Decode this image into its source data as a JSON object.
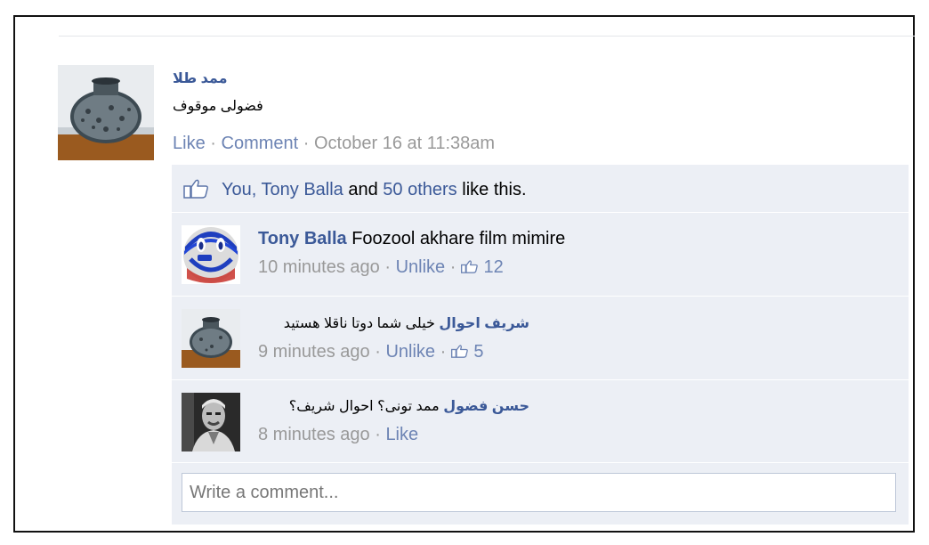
{
  "post": {
    "author": "ممد طلا",
    "text": "فضولی موقوف",
    "like_label": "Like",
    "comment_label": "Comment",
    "timestamp": "October 16 at 11:38am",
    "separator": "·"
  },
  "likes": {
    "you": "You,",
    "person": "Tony Balla",
    "and": "and",
    "others": "50 others",
    "suffix": "like this."
  },
  "comments": [
    {
      "author": "Tony Balla",
      "text": "Foozool akhare film mimire",
      "time": "10 minutes ago",
      "action": "Unlike",
      "like_count": "12"
    },
    {
      "author": "شریف احوال",
      "text": "خیلی شما دوتا ناقلا هستید",
      "time": "9 minutes ago",
      "action": "Unlike",
      "like_count": "5"
    },
    {
      "author": "حسن فضول",
      "text": "ممد تونی؟ احوال شریف؟",
      "time": "8 minutes ago",
      "action": "Like"
    }
  ],
  "composer": {
    "placeholder": "Write a comment..."
  },
  "icons": {
    "like": "thumbs-up-icon"
  },
  "colors": {
    "link": "#3b5998",
    "meta_link": "#6d84b4",
    "feedback_bg": "#eceff5"
  }
}
